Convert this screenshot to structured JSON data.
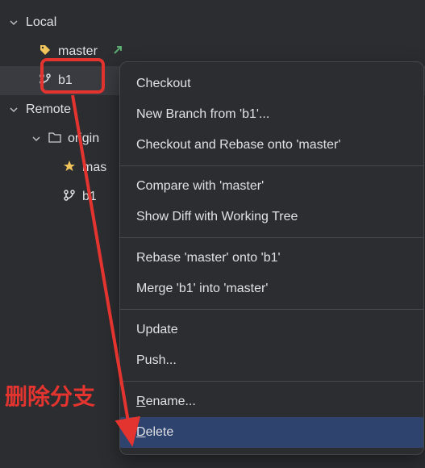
{
  "tree": {
    "local_label": "Local",
    "master_label": "master",
    "b1_label": "b1",
    "remote_label": "Remote",
    "origin_label": "origin",
    "origin_master": "mas",
    "origin_b1": "b1"
  },
  "menu": {
    "checkout": "Checkout",
    "new_branch": "New Branch from 'b1'...",
    "checkout_rebase": "Checkout and Rebase onto 'master'",
    "compare": "Compare with 'master'",
    "show_diff": "Show Diff with Working Tree",
    "rebase": "Rebase 'master' onto 'b1'",
    "merge": "Merge 'b1' into 'master'",
    "update": "Update",
    "push": "Push...",
    "rename_prefix": "R",
    "rename_rest": "ename...",
    "delete_prefix": "D",
    "delete_rest": "elete"
  },
  "annotation": "删除分支"
}
